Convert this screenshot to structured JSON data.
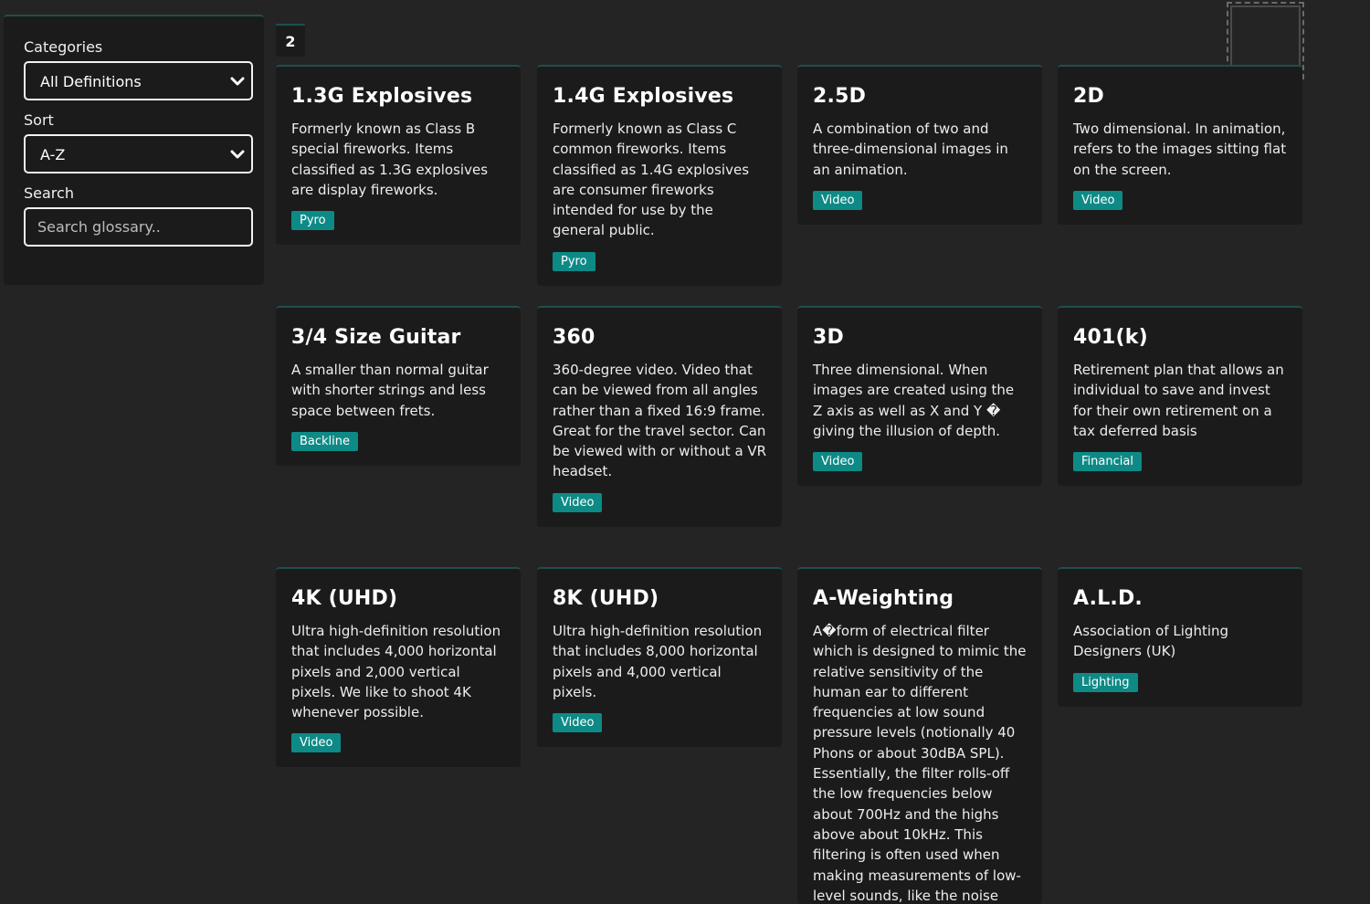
{
  "sidebar": {
    "categories_label": "Categories",
    "categories_value": "All Definitions",
    "sort_label": "Sort",
    "sort_value": "A-Z",
    "search_label": "Search",
    "search_placeholder": "Search glossary.."
  },
  "pagination": {
    "current": "2"
  },
  "cards": [
    {
      "term": "1.3G Explosives",
      "definition": "Formerly known as Class B special fireworks. Items classified as 1.3G explosives are display fireworks.",
      "tag": "Pyro"
    },
    {
      "term": "1.4G Explosives",
      "definition": "Formerly known as Class C common fireworks. Items classified as 1.4G explosives are consumer fireworks intended for use by the general public.",
      "tag": "Pyro"
    },
    {
      "term": "2.5D",
      "definition": "A combination of two and three-dimensional images in an animation.",
      "tag": "Video"
    },
    {
      "term": "2D",
      "definition": "Two dimensional. In animation, refers to the images sitting flat on the screen.",
      "tag": "Video"
    },
    {
      "term": "3/4 Size Guitar",
      "definition": "A smaller than normal guitar with shorter strings and less space between frets.",
      "tag": "Backline"
    },
    {
      "term": "360",
      "definition": "360-degree video. Video that can be viewed from all angles rather than a fixed 16:9 frame. Great for the travel sector. Can be viewed with or without a VR headset.",
      "tag": "Video"
    },
    {
      "term": "3D",
      "definition": "Three dimensional. When images are created using the Z axis as well as X and Y � giving the illusion of depth.",
      "tag": "Video"
    },
    {
      "term": "401(k)",
      "definition": "Retirement plan that allows an individual to save and invest for their own retirement on a tax deferred basis",
      "tag": "Financial"
    },
    {
      "term": "4K (UHD)",
      "definition": "Ultra high-definition resolution that includes 4,000 horizontal pixels and 2,000 vertical pixels. We like to shoot 4K whenever possible.",
      "tag": "Video"
    },
    {
      "term": "8K (UHD)",
      "definition": "Ultra high-definition resolution that includes 8,000 horizontal pixels and 4,000 vertical pixels.",
      "tag": "Video"
    },
    {
      "term": "A-Weighting",
      "definition": "A�form of electrical filter which is designed to mimic the relative sensitivity of the human ear to different frequencies at low sound pressure levels (notionally 40 Phons or about 30dBA SPL). Essentially, the filter rolls-off the low frequencies below about 700Hz and the highs above about 10kHz. This filtering is often used when making measurements of low-level sounds, like the noise floor of a device",
      "tag": ""
    },
    {
      "term": "A.L.D.",
      "definition": "Association of Lighting Designers (UK)",
      "tag": "Lighting"
    }
  ]
}
